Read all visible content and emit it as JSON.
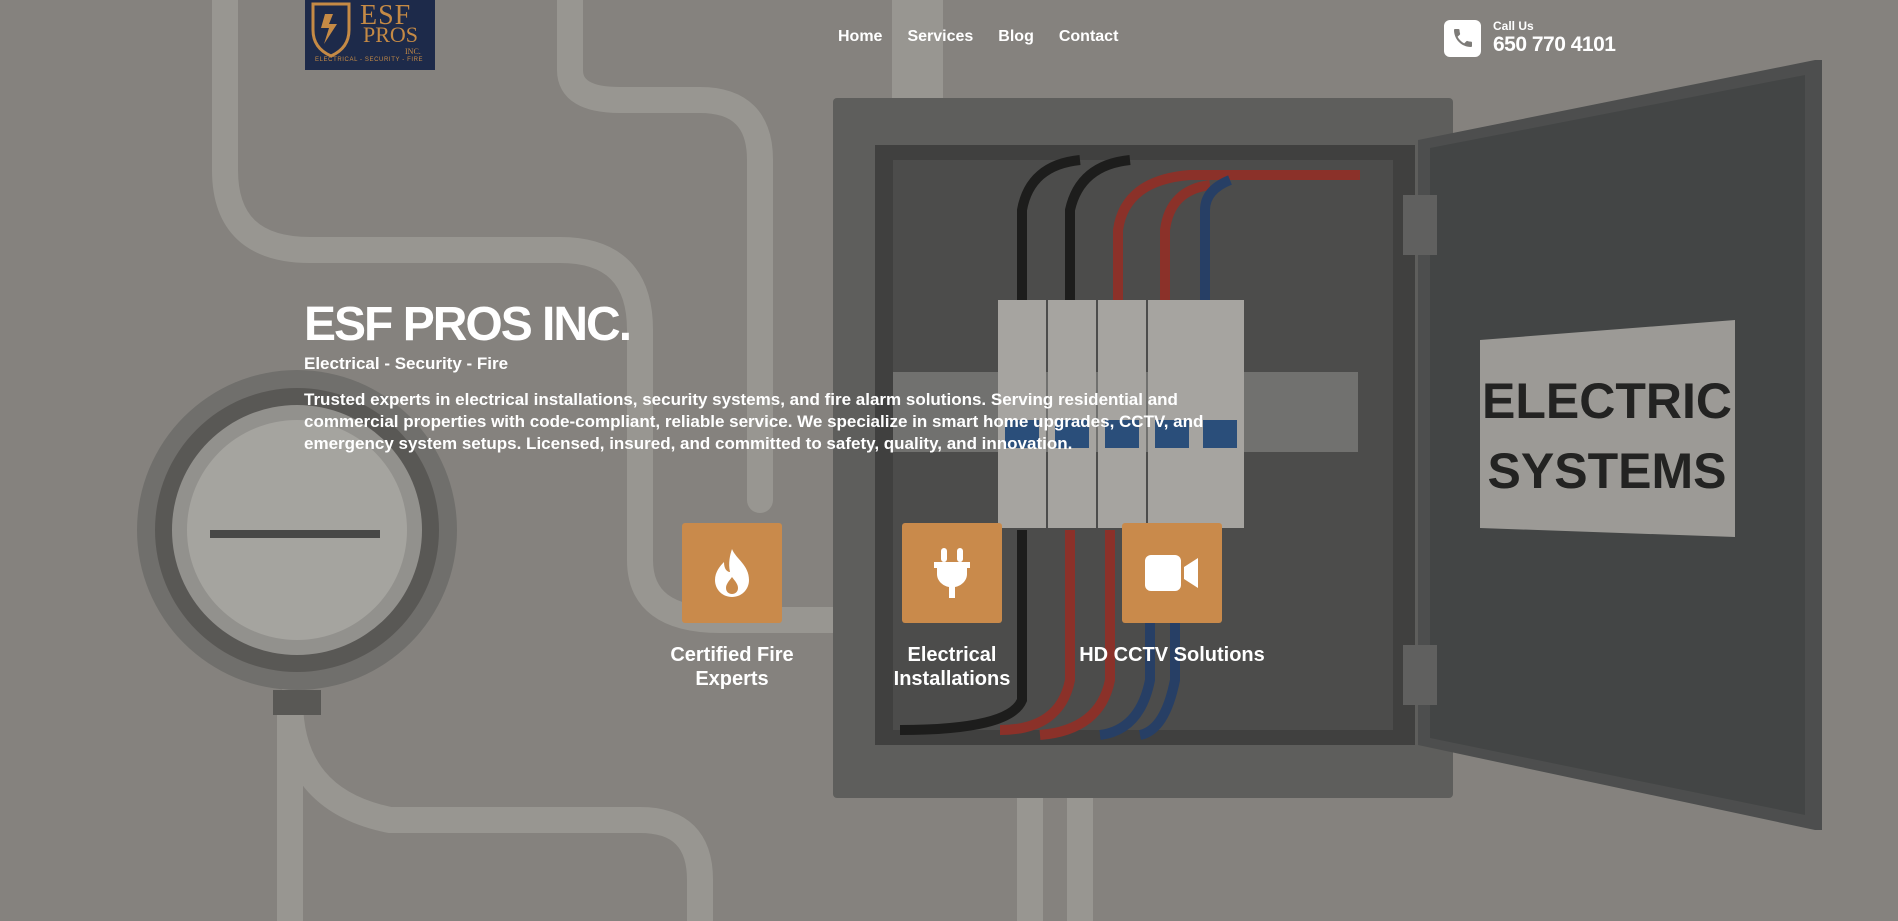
{
  "logo": {
    "name": "ESF",
    "name2": "PROS",
    "suffix": "INC.",
    "tagline": "ELECTRICAL - SECURITY - FIRE"
  },
  "nav": {
    "items": [
      "Home",
      "Services",
      "Blog",
      "Contact"
    ]
  },
  "call": {
    "label": "Call Us",
    "number": "650 770 4101",
    "icon": "phone-icon"
  },
  "hero": {
    "title": "ESF PROS INC.",
    "subtitle": "Electrical - Security - Fire",
    "description": "Trusted experts in electrical installations, security systems, and fire alarm solutions. Serving residential and commercial properties with code-compliant, reliable service. We specialize in smart home upgrades, CCTV, and emergency system setups. Licensed, insured, and committed to safety, quality, and innovation."
  },
  "background": {
    "panel_sign_line1": "ELECTRIC",
    "panel_sign_line2": "SYSTEMS"
  },
  "features": [
    {
      "label": "Certified Fire Experts",
      "icon": "fire-icon"
    },
    {
      "label": "Electrical Installations",
      "icon": "plug-icon"
    },
    {
      "label": "HD CCTV Solutions",
      "icon": "video-camera-icon"
    }
  ],
  "colors": {
    "accent": "#c98a4b",
    "logo_bg": "#1d2a4a",
    "logo_gold": "#c58a45"
  }
}
